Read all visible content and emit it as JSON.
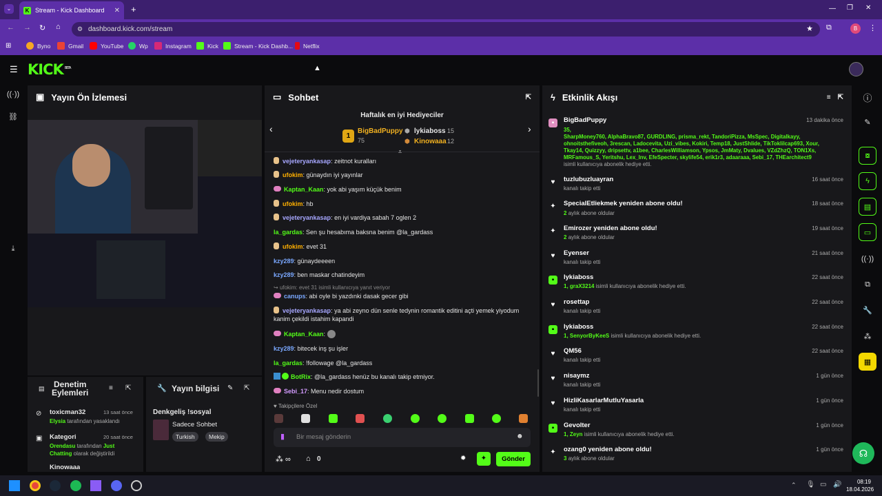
{
  "browser": {
    "tab_title": "Stream - Kick Dashboard",
    "url": "dashboard.kick.com/stream",
    "profile_initial": "B",
    "bookmarks": [
      "Byno",
      "Gmail",
      "YouTube",
      "Wp",
      "Instagram",
      "Kick",
      "Stream - Kick Dashb...",
      "Netflix"
    ]
  },
  "app": {
    "logo": "KICK",
    "logo_tag": "BETA"
  },
  "preview": {
    "title": "Yayın Ön İzlemesi"
  },
  "chat": {
    "title": "Sohbet",
    "gifters_title": "Haftalık en iyi Hediyeciler",
    "gifters": [
      {
        "rank": "1",
        "name": "BigBadPuppy",
        "count": "75"
      },
      {
        "name": "lykiaboss",
        "count": "15"
      },
      {
        "name": "Kinowaaa",
        "count": "12"
      }
    ],
    "messages": [
      {
        "user": "vejeteryankasap",
        "text": ": zeitnot kuralları"
      },
      {
        "user": "ufokim",
        "text": ": günaydın iyi yayınlar"
      },
      {
        "user": "Kaptan_Kaan",
        "text": ": yok abi yaşım küçük benim"
      },
      {
        "user": "ufokim",
        "text": ": hb"
      },
      {
        "user": "vejeteryankasap",
        "text": ": en iyi vardiya sabah 7 oglen 2"
      },
      {
        "user": "la_gardas",
        "text": ": Sen şu hesabıma baksna benim @la_gardass"
      },
      {
        "user": "ufokim",
        "text": ": evet 31"
      },
      {
        "user": "kzy289",
        "text": ": günaydeeeen"
      },
      {
        "user": "kzy289",
        "text": ": ben maskar chatindeyim"
      },
      {
        "reply": "ufokim: evet 31 isimli kullanıcıya yanıt veriyor"
      },
      {
        "user": "canups",
        "text": ": abi oyle bi yazdınki dasak gecer gibi"
      },
      {
        "user": "vejeteryankasap",
        "text": ": ya abi zeyno dün senle tedynin romantik editini açti yemek yiyodum",
        "text2": "kanim çekildi istahim kapandi"
      },
      {
        "user": "Kaptan_Kaan",
        "text": ":"
      },
      {
        "user": "kzy289",
        "text": ": bitecek inş şu işler"
      },
      {
        "user": "la_gardas",
        "text": ": !followage @la_gardass"
      },
      {
        "user": "BotRix",
        "text": ": @la_gardass henüz bu kanalı takip etmiyor."
      },
      {
        "user": "Sebi_17",
        "text": ": Menu nedir dostum"
      }
    ],
    "emote_section": "Takipçilere Özel",
    "input_placeholder": "Bir mesaj gönderin",
    "points": "0",
    "send_label": "Gönder"
  },
  "activity": {
    "title": "Etkinlik Akışı",
    "items": [
      {
        "name": "BigBadPuppy",
        "time": "13 dakika önce",
        "count": "35,",
        "list1": "SharpMoney760, AlphaBravo87, GURDLING, prisma_rekt, TandoriPizza, MsSpec, Digitalkayy,",
        "list2": "ohnoitsthefiveoh, 3rescan, Ladocevita, Uzi_vibes, Kokiri, Temp18, JustShlide, TikToklilcap693, Xour,",
        "list3": "Tkay14, Quizzyy, dripsettv, a1bee, CharlesWilliamson, Ypsos, JmMaty, Dvalues, VZdZhzQ, TON1Xs,",
        "list4": "MRFamous_S, Yeritshu, Lex_lnv, EfeSpecter, skylife54, erik1r3, adaaraaa, Sebi_17, THEarchitect9",
        "sub": "isimli kullanıcıya abonelik hediye etti."
      },
      {
        "name": "tuzlubuzluayran",
        "sub": "kanalı takip etti",
        "time": "16 saat önce"
      },
      {
        "name": "SpecialEtliekmek yeniden abone oldu!",
        "gsub": "2",
        "sub": "aylık abone oldular",
        "time": "18 saat önce"
      },
      {
        "name": "Emirozer yeniden abone oldu!",
        "gsub": "2",
        "sub": "aylık abone oldular",
        "time": "19 saat önce"
      },
      {
        "name": "Eyenser",
        "sub": "kanalı takip etti",
        "time": "21 saat önce"
      },
      {
        "name": "lykiaboss",
        "gsub": "1, graX3214",
        "sub": "isimli kullanıcıya abonelik hediye etti.",
        "time": "22 saat önce"
      },
      {
        "name": "rosettap",
        "sub": "kanalı takip etti",
        "time": "22 saat önce"
      },
      {
        "name": "lykiaboss",
        "gsub": "1, SenyorByKeeS",
        "sub": "isimli kullanıcıya abonelik hediye etti.",
        "time": "22 saat önce"
      },
      {
        "name": "QM56",
        "sub": "kanalı takip etti",
        "time": "22 saat önce"
      },
      {
        "name": "nisaymz",
        "sub": "kanalı takip etti",
        "time": "1 gün önce"
      },
      {
        "name": "HizliKasarlarMutluYasarla",
        "sub": "kanalı takip etti",
        "time": "1 gün önce"
      },
      {
        "name": "Gevolter",
        "gsub": "1, Zeyn",
        "sub": "isimli kullanıcıya abonelik hediye etti.",
        "time": "1 gün önce"
      },
      {
        "name": "ozang0 yeniden abone oldu!",
        "gsub": "3",
        "sub": "aylık abone oldular",
        "time": "1 gün önce"
      }
    ]
  },
  "moderation": {
    "title_line1": "Denetim",
    "title_line2": "Eylemleri",
    "items": [
      {
        "name": "toxicman32",
        "time": "13 saat önce",
        "actor": "Elysia",
        "desc": "tarafından yasaklandı"
      },
      {
        "name": "Kategori",
        "time": "20 saat önce",
        "actor": "Orendasu",
        "desc": "tarafından",
        "value": "Just",
        "value2": "Chatting",
        "desc2": "olarak değiştirildi"
      },
      {
        "name": "Kinowaaa"
      }
    ]
  },
  "stream_info": {
    "title": "Yayın bilgisi",
    "stream_title": "Denkgeliş !sosyal",
    "category": "Sadece Sohbet",
    "tags": [
      "Turkish",
      "Mekip"
    ]
  },
  "taskbar": {
    "time": "08:19",
    "date": "18.04.2026"
  }
}
